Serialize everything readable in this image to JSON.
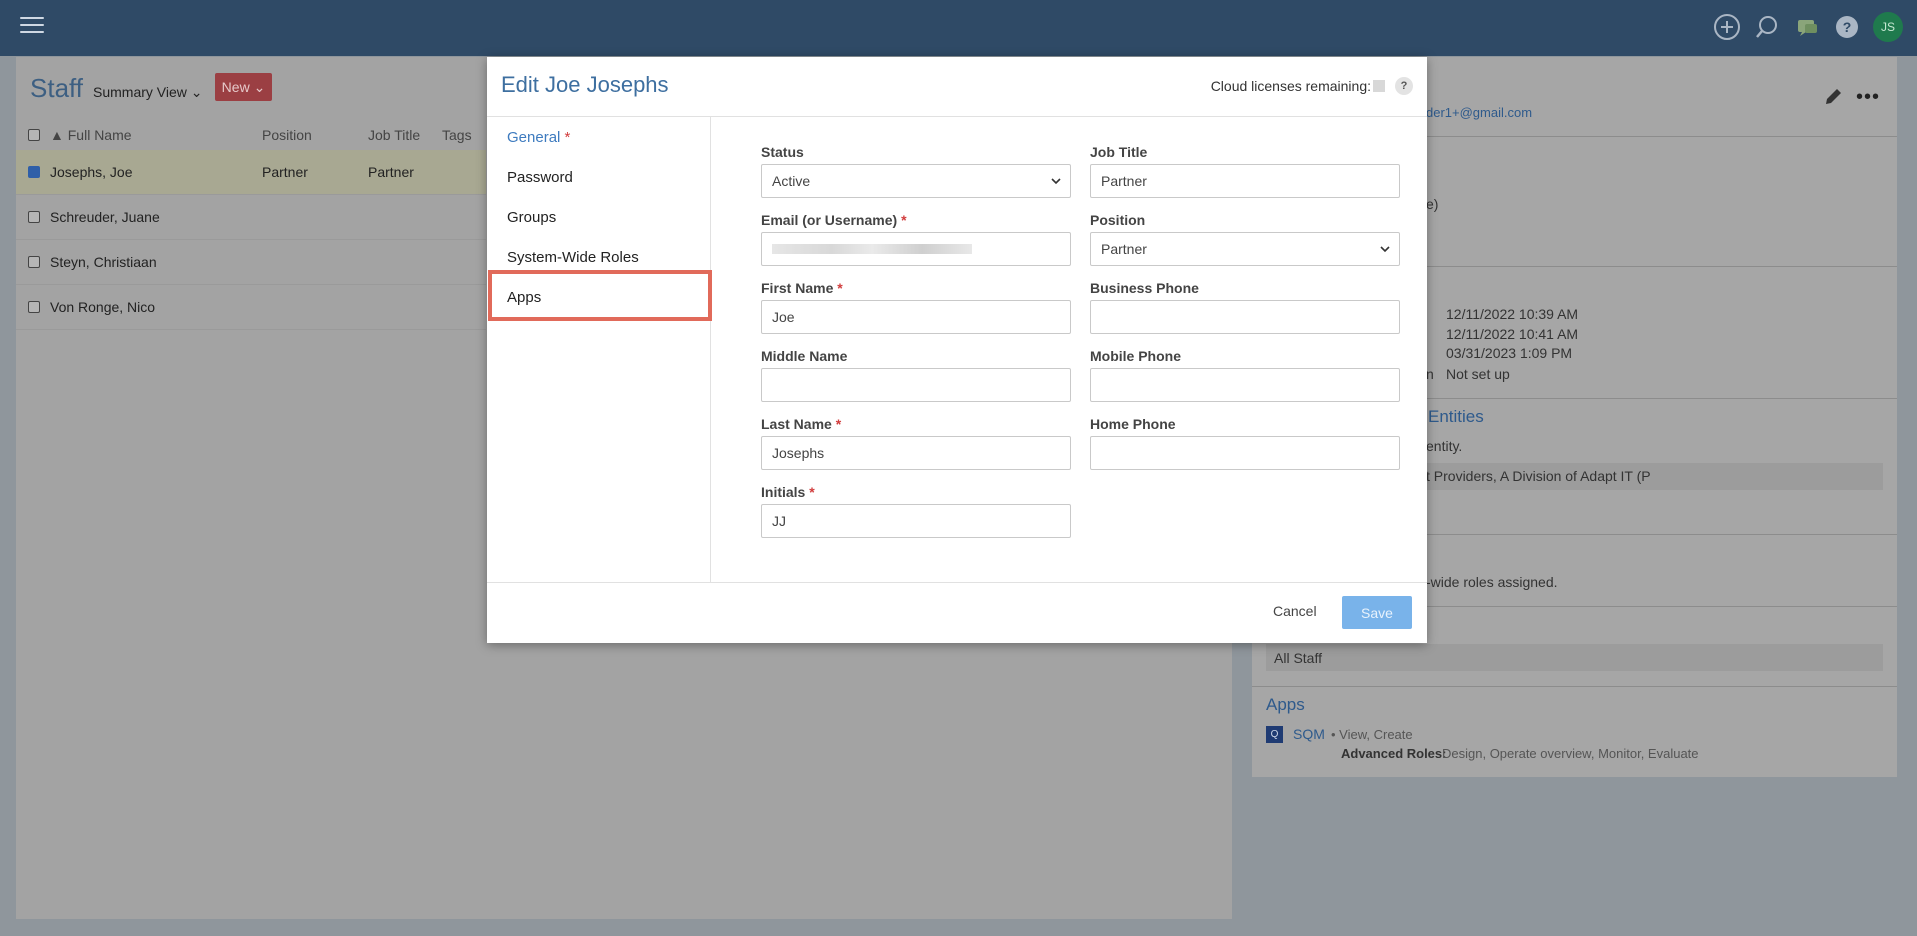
{
  "app": {
    "avatar_initials": "JS",
    "staff_title": "Staff",
    "summary_view": "Summary View",
    "new_label": "New"
  },
  "table": {
    "headers": [
      "Full Name",
      "Position",
      "Job Title",
      "Tags"
    ],
    "rows": [
      {
        "name": "Josephs, Joe",
        "position": "Partner",
        "job_title": "Partner",
        "checked": true
      },
      {
        "name": "Schreuder, Juane",
        "position": "",
        "job_title": "",
        "checked": false
      },
      {
        "name": "Steyn, Christiaan",
        "position": "",
        "job_title": "",
        "checked": false
      },
      {
        "name": "Von Ronge, Nico",
        "position": "",
        "job_title": "",
        "checked": false
      }
    ]
  },
  "detail": {
    "email_partial": "der1+@gmail.com",
    "paren_partial": "e)",
    "dates": [
      "12/11/2022 10:39 AM",
      "12/11/2022 10:41 AM",
      "03/31/2023 1:09 PM"
    ],
    "not_setup_prefix": "n",
    "not_setup": "Not set up",
    "entities_heading": "Entities",
    "entity_text": "entity.",
    "provider_text": "t Providers, A Division of Adapt IT (P",
    "roles_text": "-wide roles assigned.",
    "group_all_staff": "All Staff",
    "apps_heading": "Apps",
    "app_badge": "Q",
    "app_name": "SQM",
    "app_perms": "• View, Create",
    "advanced_roles_label": "Advanced Roles:",
    "advanced_roles": "Design, Operate overview, Monitor, Evaluate"
  },
  "modal": {
    "title": "Edit Joe Josephs",
    "licenses_label": "Cloud licenses remaining:",
    "help": "?",
    "nav": {
      "general": "General",
      "password": "Password",
      "groups": "Groups",
      "system_roles": "System-Wide Roles",
      "apps": "Apps"
    },
    "required_marker": "*",
    "fields": {
      "status_label": "Status",
      "status_value": "Active",
      "job_title_label": "Job Title",
      "job_title_value": "Partner",
      "email_label": "Email (or Username)",
      "position_label": "Position",
      "position_value": "Partner",
      "first_name_label": "First Name",
      "first_name_value": "Joe",
      "business_phone_label": "Business Phone",
      "business_phone_value": "",
      "middle_name_label": "Middle Name",
      "middle_name_value": "",
      "mobile_phone_label": "Mobile Phone",
      "mobile_phone_value": "",
      "last_name_label": "Last Name",
      "last_name_value": "Josephs",
      "home_phone_label": "Home Phone",
      "home_phone_value": "",
      "initials_label": "Initials",
      "initials_value": "JJ"
    },
    "cancel": "Cancel",
    "save": "Save"
  },
  "colors": {
    "accent": "#3e7bbf",
    "highlight": "#e16a5a",
    "save": "#79b3ea",
    "required": "#d13c3c"
  }
}
